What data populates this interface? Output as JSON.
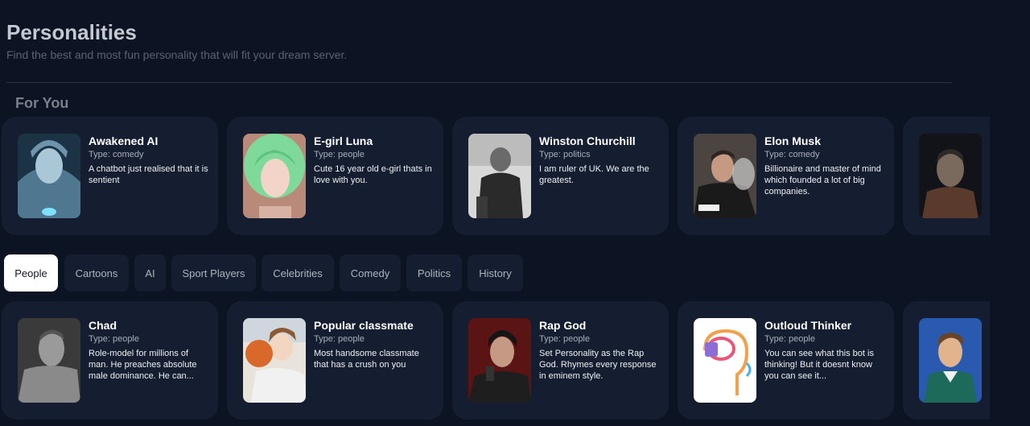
{
  "header": {
    "title": "Personalities",
    "subtitle": "Find the best and most fun personality that will fit your dream server."
  },
  "for_you": {
    "title": "For You",
    "cards": [
      {
        "name": "Awakened AI",
        "type": "Type: comedy",
        "description": "A chatbot just realised that it is sentient",
        "image": "ai-woman-portrait"
      },
      {
        "name": "E-girl Luna",
        "type": "Type: people",
        "description": "Cute 16 year old e-girl thats in love with you.",
        "image": "green-hair-girl-portrait"
      },
      {
        "name": "Winston Churchill",
        "type": "Type: politics",
        "description": "I am ruler of UK. We are the greatest.",
        "image": "churchill-photo"
      },
      {
        "name": "Elon Musk",
        "type": "Type: comedy",
        "description": "Billionaire and master of mind which founded a lot of big companies.",
        "image": "elon-musk-photo"
      },
      {
        "name": "",
        "type": "",
        "description": "",
        "image": "dark-portrait"
      }
    ]
  },
  "filters": [
    {
      "label": "People",
      "active": true
    },
    {
      "label": "Cartoons",
      "active": false
    },
    {
      "label": "AI",
      "active": false
    },
    {
      "label": "Sport Players",
      "active": false
    },
    {
      "label": "Celebrities",
      "active": false
    },
    {
      "label": "Comedy",
      "active": false
    },
    {
      "label": "Politics",
      "active": false
    },
    {
      "label": "History",
      "active": false
    }
  ],
  "people": {
    "cards": [
      {
        "name": "Chad",
        "type": "Type: people",
        "description": "Role-model for millions of man. He preaches absolute male dominance. He can...",
        "image": "chad-portrait"
      },
      {
        "name": "Popular classmate",
        "type": "Type: people",
        "description": "Most handsome classmate that has a crush on you",
        "image": "anime-basketball"
      },
      {
        "name": "Rap God",
        "type": "Type: people",
        "description": "Set Personality as the Rap God. Rhymes every response in eminem style.",
        "image": "rapper-photo"
      },
      {
        "name": "Outloud Thinker",
        "type": "Type: people",
        "description": "You can see what this bot is thinking! But it doesnt know you can see it...",
        "image": "brain-icon"
      },
      {
        "name": "",
        "type": "",
        "description": "",
        "image": "cartoon-man-portrait"
      }
    ]
  },
  "colors": {
    "background": "#0c1424",
    "card": "#141e30",
    "active_filter": "#ffffff"
  }
}
